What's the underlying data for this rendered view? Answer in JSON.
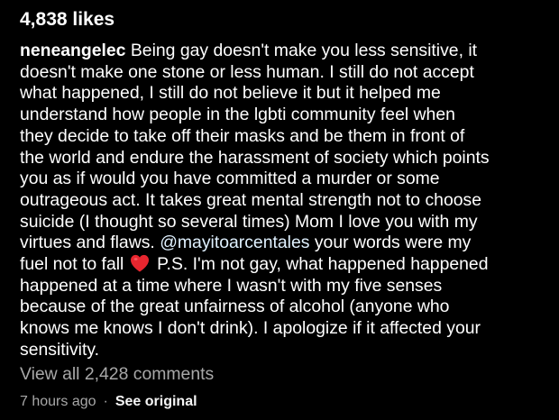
{
  "post": {
    "likes": "4,838 likes",
    "username": "neneangelec",
    "caption_lines": [
      " Being gay doesn't make you less sensitive, it",
      "doesn't make one stone or less human. I still do not accept",
      "what happened, I still do not believe it but it helped me",
      "understand how people in the lgbti community feel when",
      "they decide to take off their masks and be them in front of",
      "the world and endure the harassment of society which points",
      "you as if would you have committed a murder or some",
      "outrageous act. It takes great mental strength not to choose",
      "suicide (I thought so several times) Mom I love you with my",
      "virtues and flaws. ",
      " your words were my",
      "fuel not to fall ",
      " P.S. I'm not gay, what happened happened",
      "happened at a time where I wasn't with my five senses",
      "because of the great unfairness of alcohol (anyone who",
      "knows me knows I don't drink). I apologize if it affected your",
      "sensitivity."
    ],
    "mention": "@mayitoarcentales",
    "heart_emoji": "heart-icon",
    "heart_color": "#e8262f",
    "view_comments": "View all 2,428 comments",
    "time_ago": "7 hours ago",
    "separator": "·",
    "see_original": "See original"
  },
  "colors": {
    "background": "#000000",
    "text": "#ffffff",
    "secondary_text": "#a8a8a8"
  }
}
